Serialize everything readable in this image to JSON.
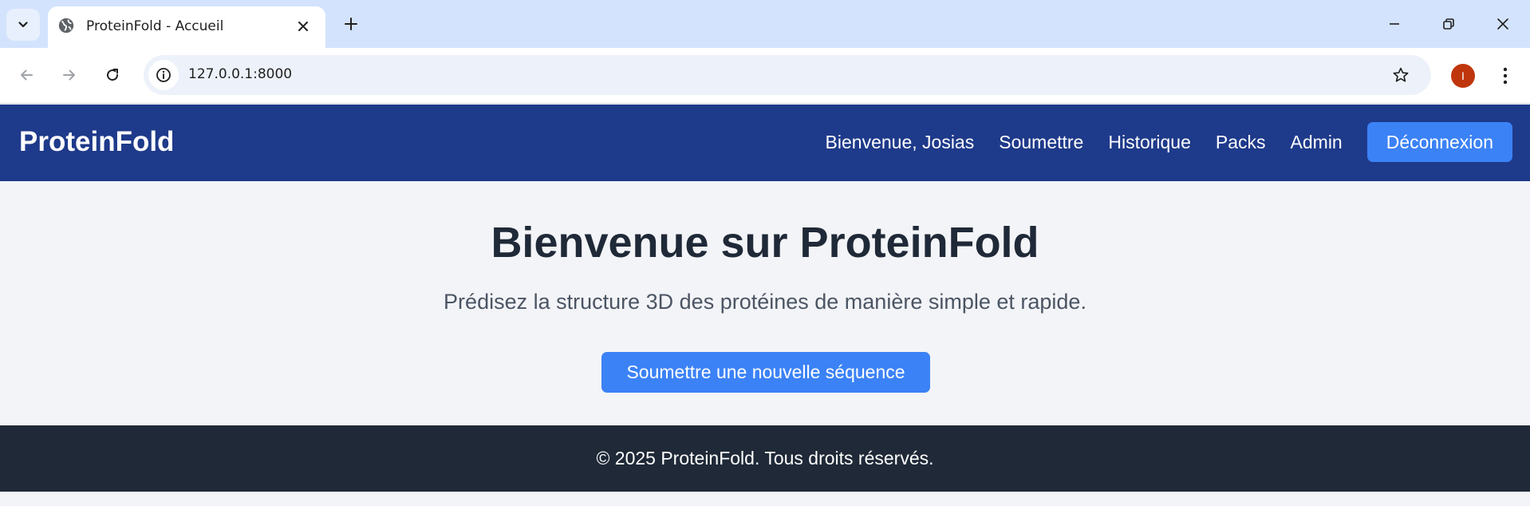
{
  "browser": {
    "tab": {
      "title": "ProteinFold - Accueil",
      "favicon": "globe-icon"
    },
    "address_bar": {
      "url": "127.0.0.1:8000"
    },
    "profile_initial": "I",
    "colors": {
      "tabbar": "#d3e3fd",
      "profile": "#c0360c"
    }
  },
  "header": {
    "brand": "ProteinFold",
    "nav": {
      "welcome": "Bienvenue, Josias",
      "submit": "Soumettre",
      "history": "Historique",
      "packs": "Packs",
      "admin": "Admin"
    },
    "logout_label": "Déconnexion"
  },
  "hero": {
    "title": "Bienvenue sur ProteinFold",
    "subtitle": "Prédisez la structure 3D des protéines de manière simple et rapide.",
    "cta_label": "Soumettre une nouvelle séquence"
  },
  "footer": {
    "text": "© 2025 ProteinFold. Tous droits réservés."
  },
  "theme": {
    "header_bg": "#1e3a8a",
    "accent": "#3b82f6",
    "footer_bg": "#1f2937",
    "page_bg": "#f3f4f8"
  }
}
